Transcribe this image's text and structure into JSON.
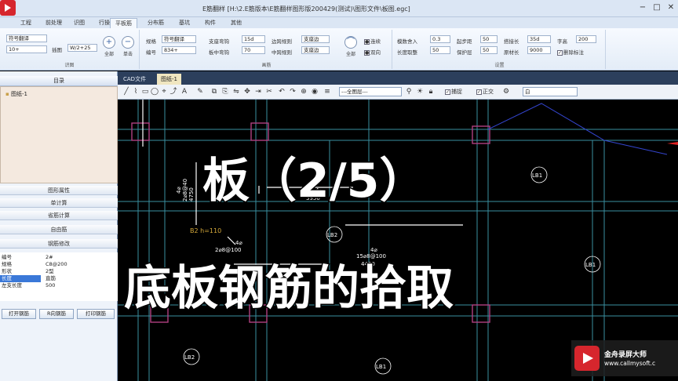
{
  "window": {
    "title": "E筋翻样  [H:\\2.E筋版本\\E筋翻样图形版200429(测试)\\图形文件\\板图.egc]",
    "controls": [
      "−",
      "□",
      "✕"
    ]
  },
  "ribbon_tabs": [
    "工程",
    "前处理",
    "识图",
    "行操作",
    "平板筋",
    "分布筋",
    "基坑",
    "构件",
    "其他"
  ],
  "ribbon": {
    "group1": {
      "caption": "识图",
      "field1": "符号翻译",
      "field2": "10+",
      "label3": "插图",
      "field3": "W/2+25",
      "btn_all": "全部",
      "btn_single": "单击"
    },
    "group2": {
      "caption": "画筋",
      "rows": [
        {
          "label": "规格",
          "value": "符号翻译",
          "label2": "支座弯钩",
          "value2": "15d",
          "label3": "边跨规则",
          "value3": "支座边"
        },
        {
          "label": "编号",
          "value": "834+",
          "label2": "板中弯钩",
          "value2": "70",
          "label3": "中跨规则",
          "value3": "支座边"
        }
      ],
      "btn_all": "全部",
      "opt1": "连续",
      "opt2": "双向"
    },
    "group3": {
      "caption": "设置",
      "rows": [
        {
          "label": "模数舍入",
          "value": "0.3",
          "label2": "起步距",
          "value2": "50",
          "label3": "搭接长",
          "value3": "35d",
          "label4": "字高",
          "value4": "200"
        },
        {
          "label": "长度取整",
          "value": "50",
          "label2": "保护层",
          "value2": "50",
          "label3": "原材长",
          "value3": "9000",
          "label4": "删除标注",
          "value4": ""
        }
      ]
    }
  },
  "left_panel": {
    "catalog_header": "目录",
    "tree_items": [
      "图纸-1"
    ],
    "sections": [
      "图形属性",
      "单计算",
      "省筋计算",
      "自由筋",
      "钢筋修改"
    ],
    "properties": [
      {
        "key": "编号",
        "value": "2#"
      },
      {
        "key": "规格",
        "value": "C8@200"
      },
      {
        "key": "形状",
        "value": "2型"
      },
      {
        "key": "长度",
        "value": "直筋"
      },
      {
        "key": "左支长度",
        "value": "500"
      }
    ],
    "buttons": [
      "打开钢筋",
      "R向钢筋",
      "打印钢筋"
    ]
  },
  "doc_tabs": [
    "CAD文件",
    "图纸-1"
  ],
  "draw_toolbar": {
    "icons": [
      "line-icon",
      "polyline-icon",
      "rect-icon",
      "circle-icon",
      "measure-icon",
      "text-icon",
      "pen-icon",
      "layer-icon",
      "copy-icon",
      "mirror-icon",
      "move-icon",
      "offset-icon",
      "trim-icon",
      "undo-icon",
      "zoom-icon"
    ],
    "layer_select": "---全图层---",
    "check1": "捕捉",
    "check2": "正交",
    "select2": "白"
  },
  "canvas": {
    "annotations": [
      "4⌀",
      "2⌀8@40",
      "4750",
      "B2 h=110",
      "4⌀",
      "2⌀8@100",
      "4⌀",
      "15⌀8@100",
      "4⌀",
      "3950",
      "4450"
    ],
    "slab_labels": [
      "LB1",
      "LB2",
      "LB1",
      "LB2",
      "LB1"
    ]
  },
  "overlay": {
    "line1": "板（2/5）",
    "line2": "底板钢筋的拾取"
  },
  "watermark": {
    "top_left": "金舟录屏大师",
    "brand": "金舟录屏大师",
    "url": "www.callmysoft.c"
  },
  "colors": {
    "cad_bg": "#000000",
    "wall_line": "#3a8fa0",
    "rebar_line": "#ffffff",
    "marker": "#b04080",
    "brand_red": "#d6262d"
  }
}
